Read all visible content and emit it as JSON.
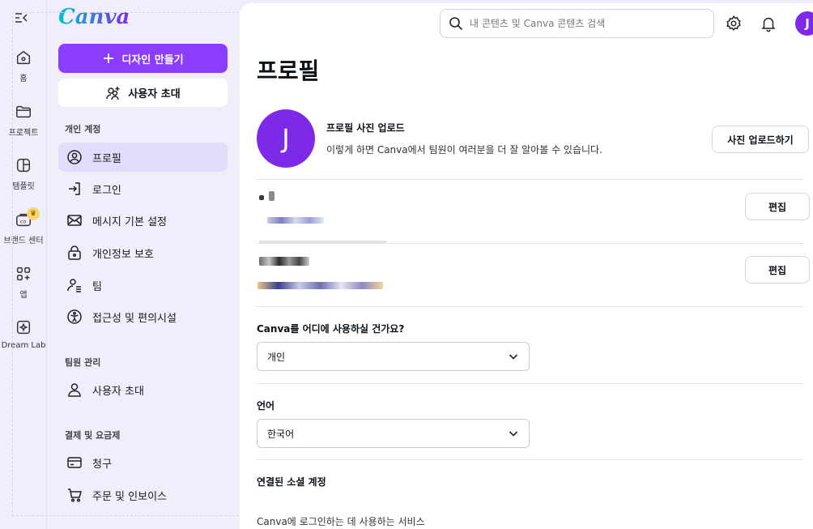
{
  "rail": {
    "items": [
      {
        "label": "홈",
        "icon": "home-icon"
      },
      {
        "label": "프로젝트",
        "icon": "folder-icon"
      },
      {
        "label": "템플릿",
        "icon": "template-icon"
      },
      {
        "label": "브랜드 센터",
        "icon": "brand-icon"
      },
      {
        "label": "앱",
        "icon": "apps-icon"
      },
      {
        "label": "Dream Lab",
        "icon": "dream-lab-icon"
      }
    ]
  },
  "sidebar": {
    "logo": "Canva",
    "create_label": "디자인 만들기",
    "invite_label": "사용자 초대",
    "sections": [
      {
        "title": "개인 계정",
        "items": [
          "프로필",
          "로그인",
          "메시지 기본 설정",
          "개인정보 보호",
          "팀",
          "접근성 및 편의시설"
        ]
      },
      {
        "title": "팀원 관리",
        "items": [
          "사용자 초대"
        ]
      },
      {
        "title": "결제 및 요금제",
        "items": [
          "청구",
          "주문 및 인보이스"
        ]
      }
    ]
  },
  "header": {
    "search_placeholder": "내 콘텐츠 및 Canva 콘텐츠 검색",
    "avatar_initial": "J"
  },
  "profile": {
    "title": "프로필",
    "avatar_initial": "J",
    "photo_title": "프로필 사진 업로드",
    "photo_desc": "이렇게 하면 Canva에서 팀원이 여러분을 더 잘 알아볼 수 있습니다.",
    "upload_label": "사진 업로드하기",
    "edit_label": "편집",
    "usage_question": "Canva를 어디에 사용하실 건가요?",
    "usage_value": "개인",
    "language_label": "언어",
    "language_value": "한국어",
    "social_title": "연결된 소셜 계정",
    "social_desc": "Canva에 로그인하는 데 사용하는 서비스"
  }
}
